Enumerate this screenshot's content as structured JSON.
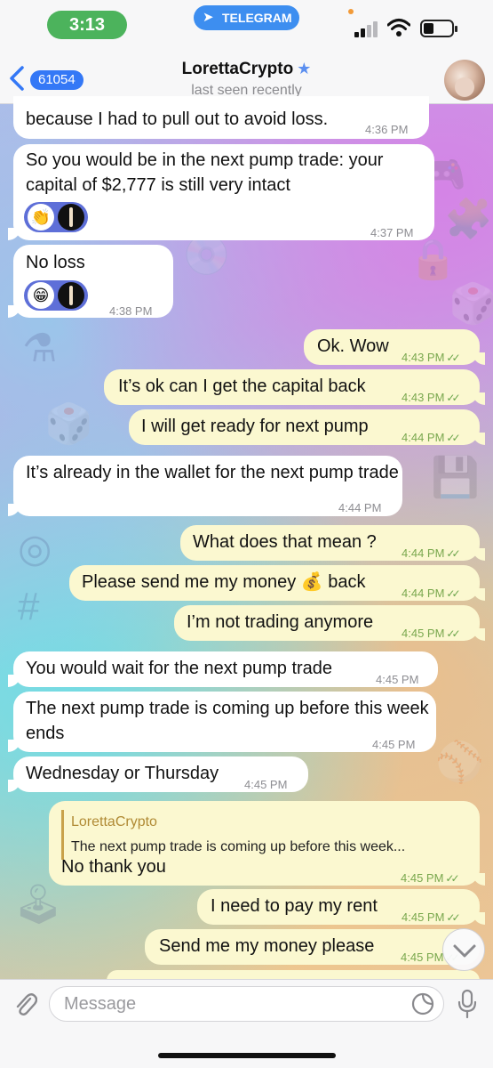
{
  "status_bar": {
    "time": "3:13",
    "telegram_pill": "TELEGRAM"
  },
  "header": {
    "back_count": "61054",
    "title": "LorettaCrypto",
    "subtitle": "last seen recently"
  },
  "messages": [
    {
      "dir": "in",
      "text": "because I had to pull out to avoid loss.",
      "time": "4:36 PM"
    },
    {
      "dir": "in",
      "text": "So you would be in the next pump trade: your capital of $2,777 is still very intact",
      "time": "4:37 PM",
      "reaction": "👏"
    },
    {
      "dir": "in",
      "text": "No loss",
      "time": "4:38 PM",
      "reaction": "😁"
    },
    {
      "dir": "out",
      "text": "Ok. Wow",
      "time": "4:43 PM"
    },
    {
      "dir": "out",
      "text": "It’s ok can I get the capital back",
      "time": "4:43 PM"
    },
    {
      "dir": "out",
      "text": "I will get ready for next pump",
      "time": "4:44 PM"
    },
    {
      "dir": "in",
      "text": "It’s already in the wallet for the next pump trade",
      "time": "4:44 PM"
    },
    {
      "dir": "out",
      "text": "What does that mean ?",
      "time": "4:44 PM"
    },
    {
      "dir": "out",
      "text": "Please send me my money 💰 back",
      "time": "4:44 PM"
    },
    {
      "dir": "out",
      "text": "I’m not trading anymore",
      "time": "4:45 PM"
    },
    {
      "dir": "in",
      "text": "You would wait for the next pump trade",
      "time": "4:45 PM"
    },
    {
      "dir": "in",
      "text": "The next pump trade is coming up before this week ends",
      "time": "4:45 PM"
    },
    {
      "dir": "in",
      "text": "Wednesday or Thursday",
      "time": "4:45 PM"
    },
    {
      "dir": "out",
      "text": "No thank you",
      "time": "4:45 PM",
      "reply_name": "LorettaCrypto",
      "reply_text": "The next pump trade is coming up before this week..."
    },
    {
      "dir": "out",
      "text": "I need to pay my rent",
      "time": "4:45 PM"
    },
    {
      "dir": "out",
      "text": "Send me my money please",
      "time": "4:45 PM"
    }
  ],
  "input": {
    "placeholder": "Message"
  },
  "icons": {
    "back": "chevron-left-icon",
    "verified": "star-icon",
    "attach": "paperclip-icon",
    "sticker": "sticker-icon",
    "mic": "microphone-icon",
    "scroll": "chevron-down-icon"
  },
  "colors": {
    "accent": "#3478f6",
    "outgoing_bubble": "#fbf8d0",
    "incoming_bubble": "#ffffff",
    "time_pill": "#4cb35c"
  }
}
